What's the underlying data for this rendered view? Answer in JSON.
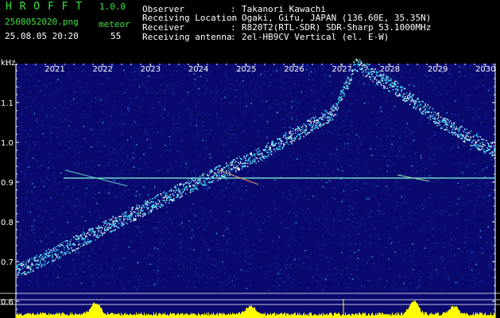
{
  "header": {
    "app_title": "H R O F F T",
    "version": "1.0.0",
    "filename": "2508052020.png",
    "meteor_label": "meteor",
    "datetime": "25.08.05 20:20",
    "meteor_count": "55",
    "info": [
      {
        "label": "Observer",
        "value": "Takanori Kawachi"
      },
      {
        "label": "Receiving Location",
        "value": "Ogaki, Gifu, JAPAN (136.60E, 35.35N)"
      },
      {
        "label": "Receiver",
        "value": "R820T2(RTL-SDR) SDR-Sharp 53.1000MHz"
      },
      {
        "label": "Receiving antenna",
        "value": "2el-HB9CV Vertical (el. E-W)"
      }
    ]
  },
  "spectrogram": {
    "unit_label": "kHz",
    "freq_ticks": [
      "1.1",
      "1.0",
      "0.9",
      "0.8",
      "0.7",
      "0.6"
    ],
    "time_ticks": [
      "2021",
      "2022",
      "2023",
      "2024",
      "2025",
      "2026",
      "2027",
      "2028",
      "2029",
      "2030"
    ],
    "colors": {
      "background": "#0a0a6e",
      "grid": "#ffffff",
      "trace": "#5ff0ff",
      "carrier": "#7fffd4",
      "histogram": "#ffff00",
      "tick_text": "#ffffff"
    }
  }
}
